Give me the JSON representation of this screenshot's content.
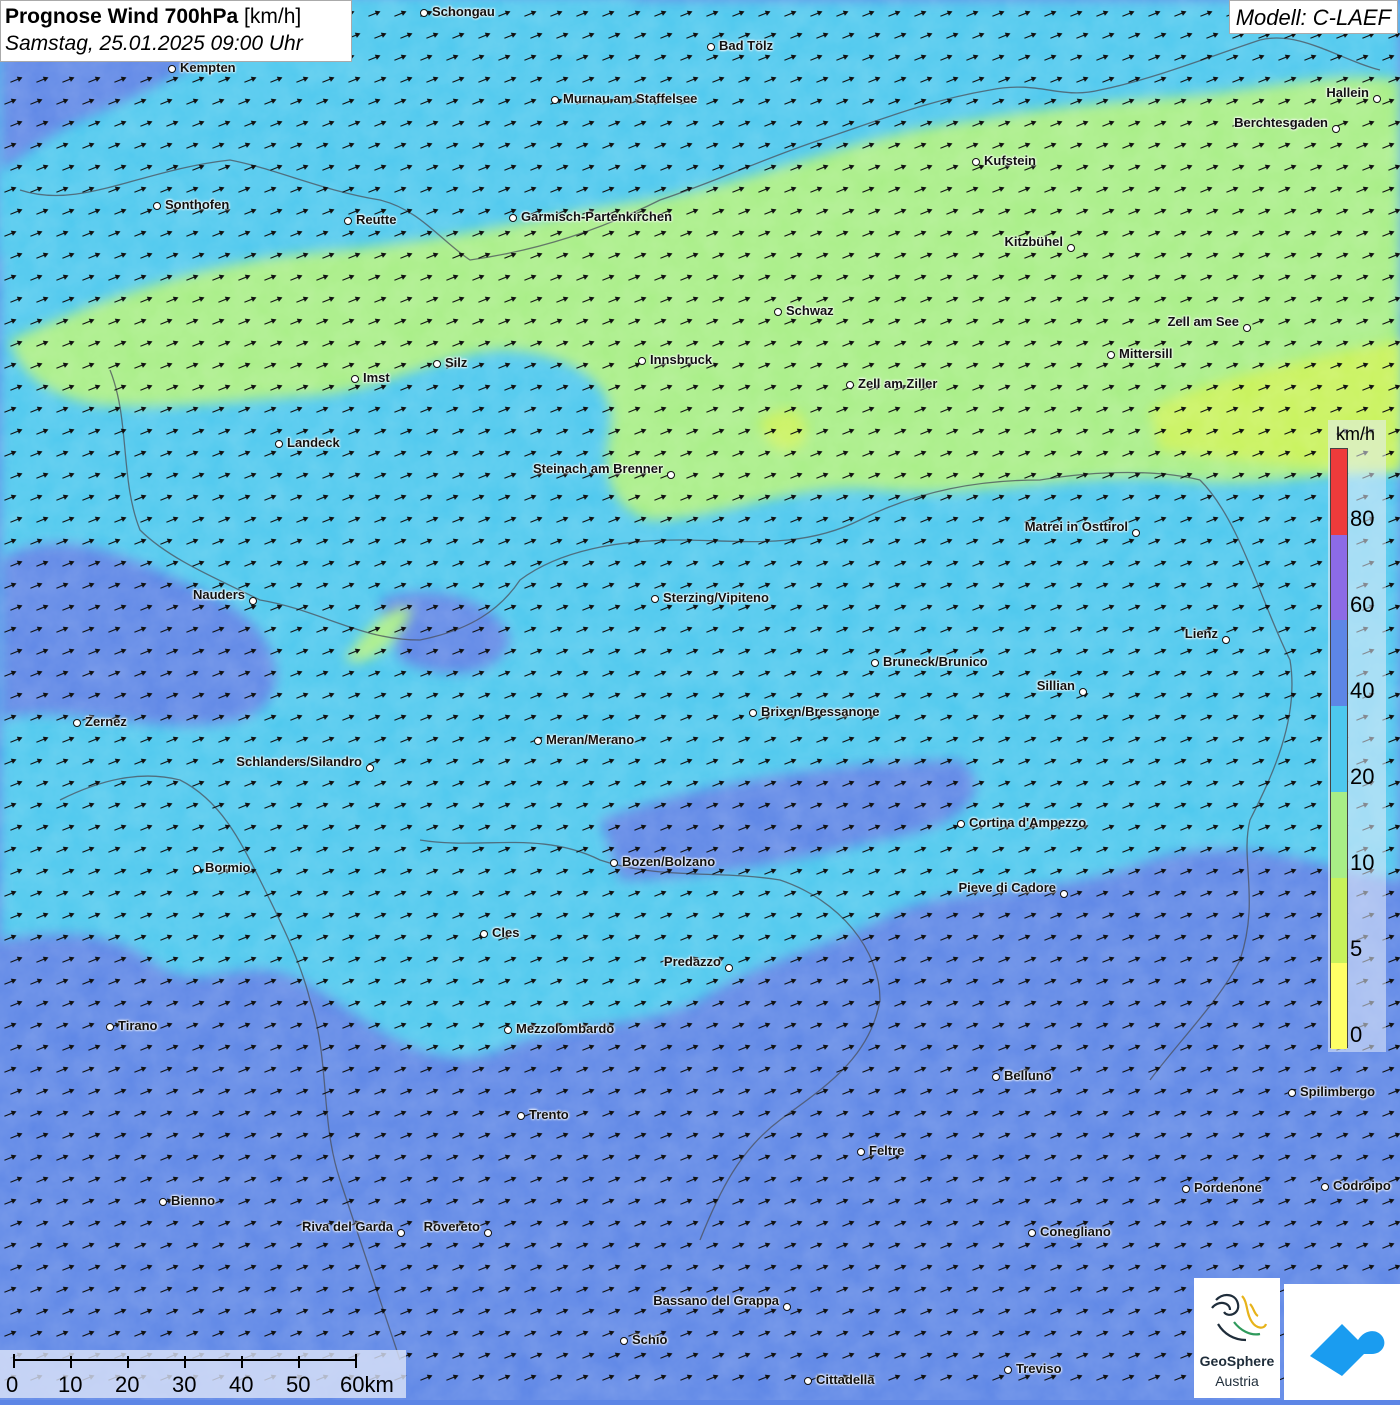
{
  "header": {
    "title": "Prognose Wind 700hPa",
    "unit": "[km/h]",
    "datetime": "Samstag, 25.01.2025 09:00 Uhr",
    "model": "Modell: C-LAEF"
  },
  "colors": {
    "c0": "#ffff66",
    "c5": "#c8f25a",
    "c10": "#a8ee86",
    "c20": "#4dc8ee",
    "c40": "#5d86e6",
    "c60": "#8c6be6",
    "c80": "#ee3b3b"
  },
  "legend": {
    "unit": "km/h",
    "ticks": [
      "80",
      "60",
      "40",
      "20",
      "10",
      "5",
      "0"
    ]
  },
  "cities": [
    {
      "name": "Schongau",
      "side": "right"
    },
    {
      "name": "Bad Tölz",
      "side": "right"
    },
    {
      "name": "Kempten",
      "side": "right"
    },
    {
      "name": "Murnau am Staffelsee",
      "side": "right"
    },
    {
      "name": "Hallein",
      "side": "left"
    },
    {
      "name": "Berchtesgaden",
      "side": "left"
    },
    {
      "name": "Kufstein",
      "side": "right"
    },
    {
      "name": "Sonthofen",
      "side": "right"
    },
    {
      "name": "Reutte",
      "side": "right"
    },
    {
      "name": "Garmisch-Partenkirchen",
      "side": "right"
    },
    {
      "name": "Kitzbühel",
      "side": "left"
    },
    {
      "name": "Schwaz",
      "side": "right"
    },
    {
      "name": "Zell am See",
      "side": "left"
    },
    {
      "name": "Innsbruck",
      "side": "right"
    },
    {
      "name": "Mittersill",
      "side": "right"
    },
    {
      "name": "Silz",
      "side": "right"
    },
    {
      "name": "Imst",
      "side": "right"
    },
    {
      "name": "Zell am Ziller",
      "side": "right"
    },
    {
      "name": "Landeck",
      "side": "right"
    },
    {
      "name": "Steinach am Brenner",
      "side": "left"
    },
    {
      "name": "Matrei in Osttirol",
      "side": "left"
    },
    {
      "name": "Nauders",
      "side": "left"
    },
    {
      "name": "Sterzing/Vipiteno",
      "side": "right"
    },
    {
      "name": "Lienz",
      "side": "left"
    },
    {
      "name": "Bruneck/Brunico",
      "side": "right"
    },
    {
      "name": "Sillian",
      "side": "left"
    },
    {
      "name": "Zernez",
      "side": "right"
    },
    {
      "name": "Brixen/Bressanone",
      "side": "right"
    },
    {
      "name": "Meran/Merano",
      "side": "right"
    },
    {
      "name": "Schlanders/Silandro",
      "side": "left"
    },
    {
      "name": "Cortina d'Ampezzo",
      "side": "right"
    },
    {
      "name": "Bozen/Bolzano",
      "side": "right"
    },
    {
      "name": "Bormio",
      "side": "right"
    },
    {
      "name": "Pieve di Cadore",
      "side": "left"
    },
    {
      "name": "Cles",
      "side": "right"
    },
    {
      "name": "Predazzo",
      "side": "left"
    },
    {
      "name": "Tirano",
      "side": "right"
    },
    {
      "name": "Mezzolombardo",
      "side": "right"
    },
    {
      "name": "Belluno",
      "side": "right"
    },
    {
      "name": "Spilimbergo",
      "side": "right"
    },
    {
      "name": "Trento",
      "side": "right"
    },
    {
      "name": "Feltre",
      "side": "right"
    },
    {
      "name": "Pordenone",
      "side": "right"
    },
    {
      "name": "Codroipo",
      "side": "right"
    },
    {
      "name": "Bienno",
      "side": "right"
    },
    {
      "name": "Riva del Garda",
      "side": "left"
    },
    {
      "name": "Rovereto",
      "side": "left"
    },
    {
      "name": "Conegliano",
      "side": "right"
    },
    {
      "name": "Bassano del Grappa",
      "side": "left"
    },
    {
      "name": "Schio",
      "side": "right"
    },
    {
      "name": "Treviso",
      "side": "right"
    },
    {
      "name": "Cittadella",
      "side": "right"
    }
  ],
  "scalebar": {
    "labels": [
      "0",
      "10",
      "20",
      "30",
      "40",
      "50",
      "60km"
    ]
  },
  "logos": {
    "geosphere_line1": "GeoSphere",
    "geosphere_line2": "Austria"
  }
}
